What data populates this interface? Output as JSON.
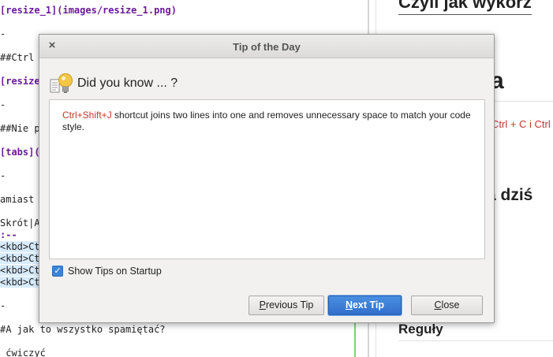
{
  "editor": {
    "lines": [
      {
        "text": "[resize_1](images/resize_1.png)",
        "kind": "link"
      },
      {
        "text": "-",
        "kind": "plain"
      },
      {
        "text": "##Ctrl -",
        "kind": "plain"
      },
      {
        "text": "[resize_",
        "kind": "link"
      },
      {
        "text": "-",
        "kind": "plain"
      },
      {
        "text": "##Nie po",
        "kind": "plain"
      },
      {
        "text": "[tabs](i",
        "kind": "link"
      },
      {
        "text": "-",
        "kind": "plain"
      },
      {
        "text": "amiast t",
        "kind": "plain"
      },
      {
        "text": "Skrót|Al",
        "kind": "plain"
      },
      {
        "text": ":--",
        "kind": "sep"
      },
      {
        "text": "<kbd>Ctr",
        "kind": "kbd"
      },
      {
        "text": "<kbd>Ctr",
        "kind": "kbd"
      },
      {
        "text": "<kbd>Ctr",
        "kind": "kbd"
      },
      {
        "text": "<kbd>Ctr",
        "kind": "kbd"
      },
      {
        "text": "-",
        "kind": "plain"
      },
      {
        "text": "#A jak to wszystko spamiętać?",
        "kind": "plain"
      },
      {
        "text": " ćwiczyć",
        "kind": "plain"
      }
    ]
  },
  "preview": {
    "heading_top": "Czyli jak wykorz",
    "heading_big": "cja",
    "shortcut_text": "Ctrl + C i Ctrl",
    "heading_mid": "a dziś",
    "heading_low": "Reguły"
  },
  "dialog": {
    "title": "Tip of the Day",
    "close_glyph": "×",
    "header": "Did you know ... ?",
    "tip": {
      "shortcut": "Ctrl+Shift+J",
      "text": " shortcut joins two lines into one and removes unnecessary space to match your code style."
    },
    "show_tips": {
      "label": "Show Tips on Startup",
      "checked": true
    },
    "buttons": {
      "previous": {
        "mnemonic": "P",
        "rest": "revious Tip"
      },
      "next": {
        "mnemonic": "N",
        "rest": "ext Tip"
      },
      "close": {
        "mnemonic": "C",
        "rest": "lose"
      }
    }
  },
  "colors": {
    "accent": "#3b84d9",
    "shortcut": "#c0392b",
    "link": "#6a1b9a"
  }
}
